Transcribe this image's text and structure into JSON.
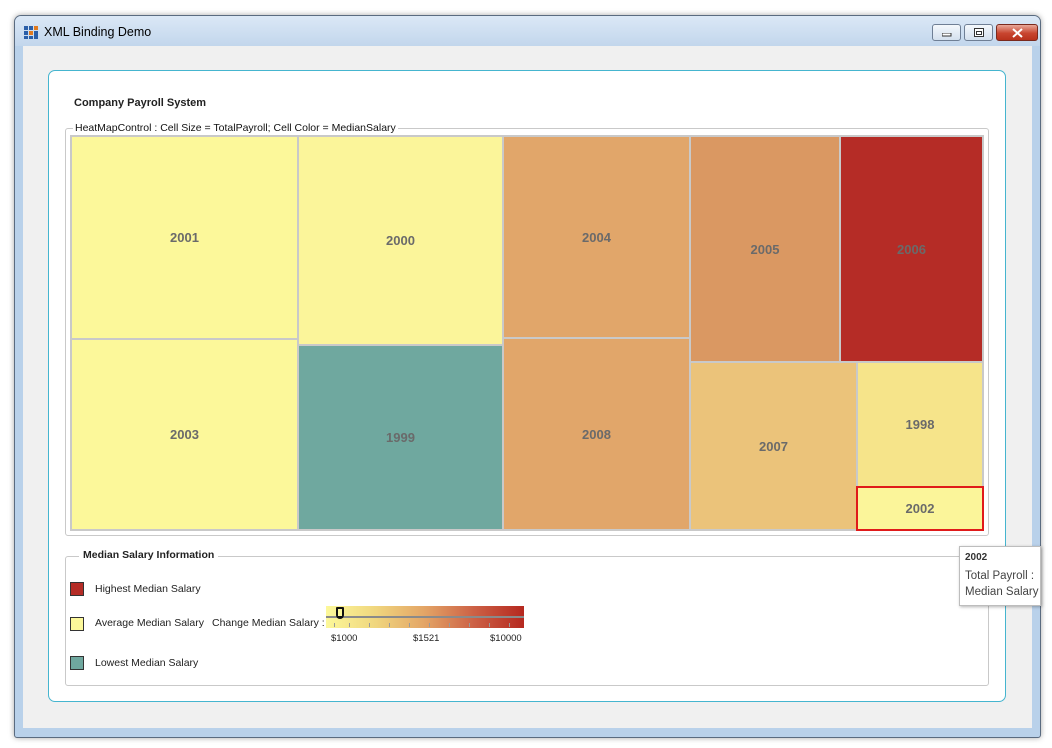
{
  "window": {
    "title": "XML Binding Demo"
  },
  "app": {
    "heading": "Company Payroll System"
  },
  "heatmap": {
    "header": "HeatMapControl : Cell Size = TotalPayroll; Cell Color = MedianSalary",
    "cells": [
      {
        "label": "2001",
        "color": "#fcf89a"
      },
      {
        "label": "2003",
        "color": "#fcf89a"
      },
      {
        "label": "2000",
        "color": "#fbf59a"
      },
      {
        "label": "1999",
        "color": "#6fa89f"
      },
      {
        "label": "2004",
        "color": "#e1a66a"
      },
      {
        "label": "2008",
        "color": "#e1a66a"
      },
      {
        "label": "2005",
        "color": "#da9862"
      },
      {
        "label": "2006",
        "color": "#b52c26"
      },
      {
        "label": "2007",
        "color": "#ebc37a"
      },
      {
        "label": "1998",
        "color": "#f6e48a"
      },
      {
        "label": "2002",
        "color": "#fbf59a",
        "selected": true
      }
    ]
  },
  "median_info": {
    "header": "Median Salary Information",
    "legend": [
      {
        "label": "Highest Median Salary",
        "color": "#b52c26"
      },
      {
        "label": "Average Median Salary",
        "color": "#fcf89a"
      },
      {
        "label": "Lowest Median Salary",
        "color": "#6fa89f"
      }
    ],
    "slider": {
      "label": "Change Median Salary :",
      "value": "$1000",
      "tick_labels": [
        "$1000",
        "$1521",
        "$10000"
      ]
    }
  },
  "tooltip": {
    "title": "2002",
    "line1": "Total Payroll :",
    "line2": "Median Salary"
  }
}
